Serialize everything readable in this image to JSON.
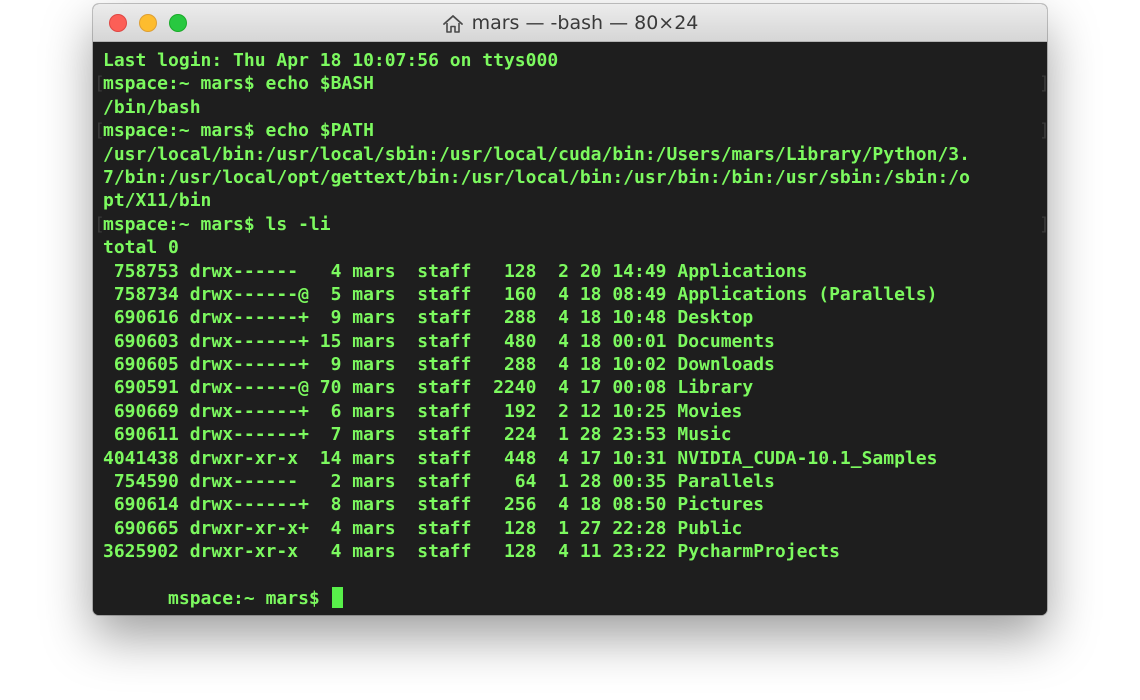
{
  "window": {
    "title": "mars — -bash — 80×24",
    "title_icon": "home-icon"
  },
  "colors": {
    "terminal_background": "#1e1e1e",
    "terminal_text": "#7cf95f",
    "cursor": "#58f04a",
    "mark": "#3a3a3a"
  },
  "terminal": {
    "lines": [
      {
        "text": "Last login: Thu Apr 18 10:07:56 on ttys000",
        "marked": false
      },
      {
        "text": "mspace:~ mars$ echo $BASH",
        "marked": true
      },
      {
        "text": "/bin/bash",
        "marked": false
      },
      {
        "text": "mspace:~ mars$ echo $PATH",
        "marked": true
      },
      {
        "text": "/usr/local/bin:/usr/local/sbin:/usr/local/cuda/bin:/Users/mars/Library/Python/3.",
        "marked": false
      },
      {
        "text": "7/bin:/usr/local/opt/gettext/bin:/usr/local/bin:/usr/bin:/bin:/usr/sbin:/sbin:/o",
        "marked": false
      },
      {
        "text": "pt/X11/bin",
        "marked": false
      },
      {
        "text": "mspace:~ mars$ ls -li",
        "marked": true
      },
      {
        "text": "total 0",
        "marked": false
      },
      {
        "text": " 758753 drwx------   4 mars  staff   128  2 20 14:49 Applications",
        "marked": false
      },
      {
        "text": " 758734 drwx------@  5 mars  staff   160  4 18 08:49 Applications (Parallels)",
        "marked": false
      },
      {
        "text": " 690616 drwx------+  9 mars  staff   288  4 18 10:48 Desktop",
        "marked": false
      },
      {
        "text": " 690603 drwx------+ 15 mars  staff   480  4 18 00:01 Documents",
        "marked": false
      },
      {
        "text": " 690605 drwx------+  9 mars  staff   288  4 18 10:02 Downloads",
        "marked": false
      },
      {
        "text": " 690591 drwx------@ 70 mars  staff  2240  4 17 00:08 Library",
        "marked": false
      },
      {
        "text": " 690669 drwx------+  6 mars  staff   192  2 12 10:25 Movies",
        "marked": false
      },
      {
        "text": " 690611 drwx------+  7 mars  staff   224  1 28 23:53 Music",
        "marked": false
      },
      {
        "text": "4041438 drwxr-xr-x  14 mars  staff   448  4 17 10:31 NVIDIA_CUDA-10.1_Samples",
        "marked": false
      },
      {
        "text": " 754590 drwx------   2 mars  staff    64  1 28 00:35 Parallels",
        "marked": false
      },
      {
        "text": " 690614 drwx------+  8 mars  staff   256  4 18 08:50 Pictures",
        "marked": false
      },
      {
        "text": " 690665 drwxr-xr-x+  4 mars  staff   128  1 27 22:28 Public",
        "marked": false
      },
      {
        "text": "3625902 drwxr-xr-x   4 mars  staff   128  4 11 23:22 PycharmProjects",
        "marked": false
      }
    ],
    "prompt": "mspace:~ mars$ "
  }
}
